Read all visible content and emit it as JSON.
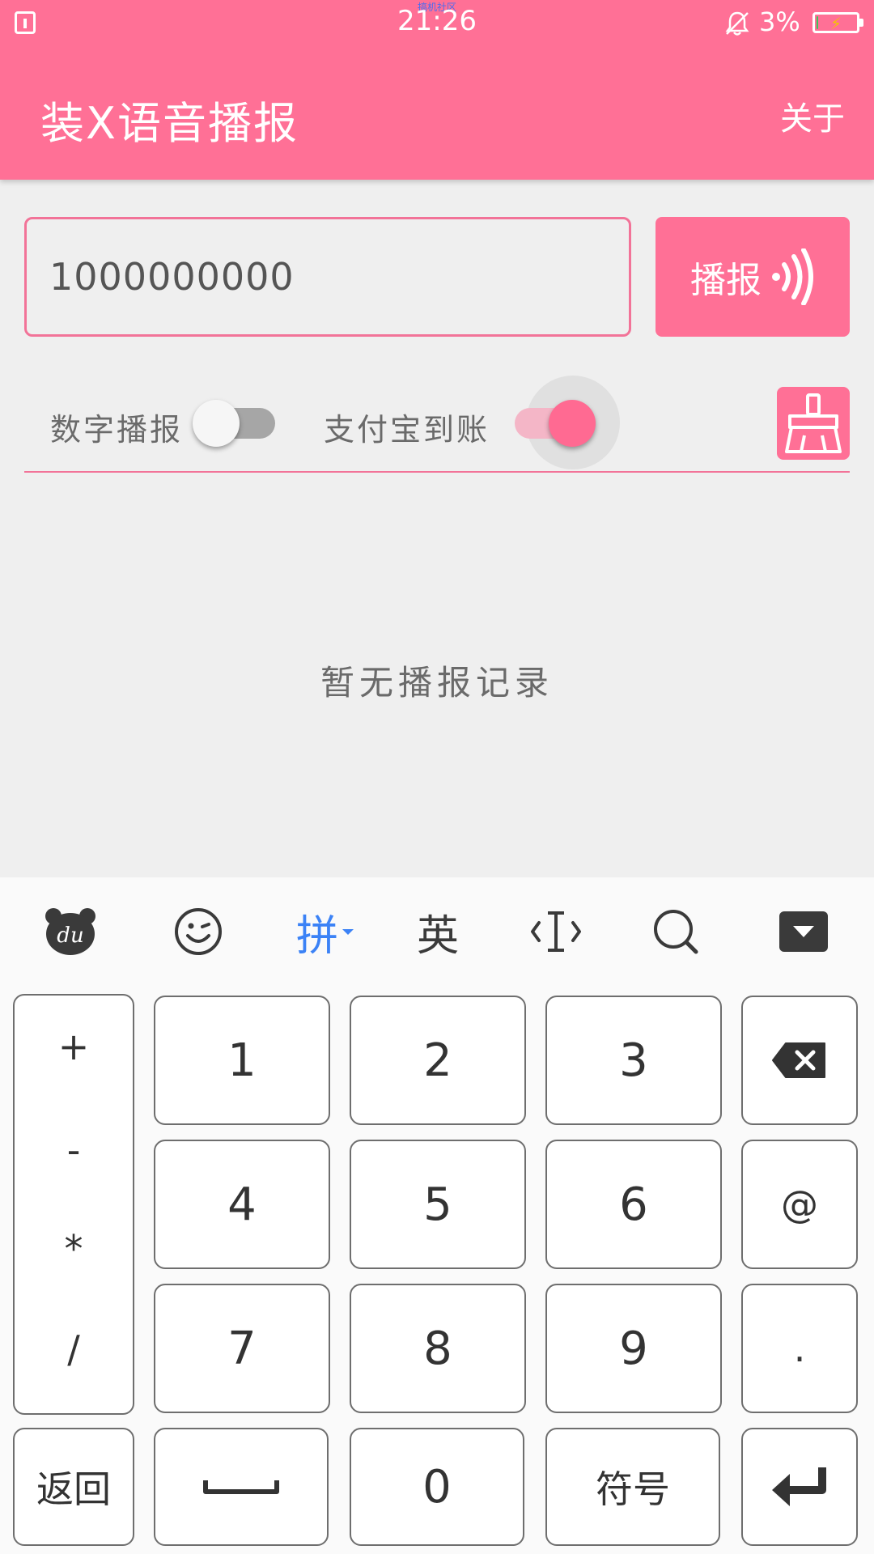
{
  "status_bar": {
    "carrier": "搞机社区",
    "time": "21:26",
    "battery": "3%",
    "battery_level": 0.03
  },
  "app_bar": {
    "title": "装X语音播报",
    "about_label": "关于"
  },
  "input": {
    "value": "1000000000",
    "placeholder": ""
  },
  "broadcast_button": {
    "label": "播报"
  },
  "options": {
    "digit_label": "数字播报",
    "digit_on": false,
    "alipay_label": "支付宝到账",
    "alipay_on": true
  },
  "empty_state": "暂无播报记录",
  "colors": {
    "accent": "#ff7096",
    "accent_border": "#f27398",
    "background": "#efefef"
  },
  "keyboard": {
    "toolbar": {
      "du_icon": "du-logo-icon",
      "emoji_icon": "wink-emoji-icon",
      "pinyin_label": "拼",
      "english_label": "英",
      "cursor_icon": "cursor-icon",
      "search_icon": "search-icon",
      "hide_icon": "hide-keyboard-icon"
    },
    "ops": [
      "+",
      "-",
      "*",
      "/"
    ],
    "digits_row1": [
      "1",
      "2",
      "3"
    ],
    "digits_row2": [
      "4",
      "5",
      "6"
    ],
    "digits_row3": [
      "7",
      "8",
      "9"
    ],
    "backspace_icon": "backspace-icon",
    "at": "@",
    "dot": ".",
    "back_label": "返回",
    "space_icon": "space-icon",
    "zero": "0",
    "symbols_label": "符号",
    "enter_icon": "enter-icon"
  }
}
